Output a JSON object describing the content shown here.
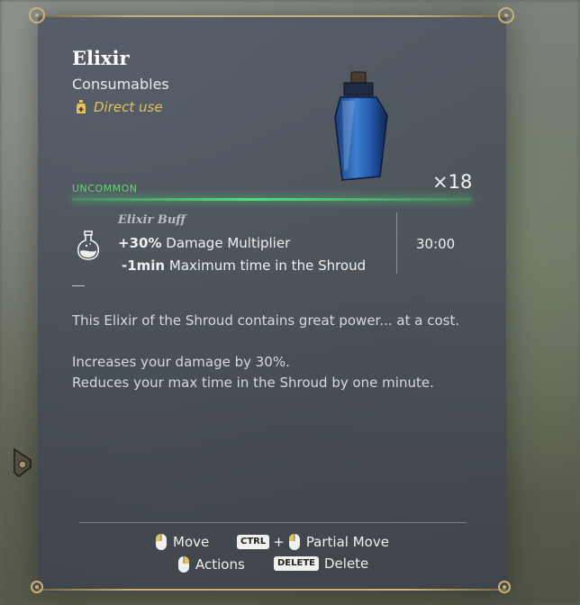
{
  "item": {
    "name": "Elixir",
    "category": "Consumables",
    "usage": "Direct use",
    "rarity": "UNCOMMON",
    "quantity": "×18"
  },
  "buff": {
    "name": "Elixir Buff",
    "effects": [
      {
        "value": "+30%",
        "label": "Damage Multiplier"
      },
      {
        "value": "-1min",
        "label": "Maximum time in the Shroud"
      }
    ],
    "duration": "30:00"
  },
  "description": {
    "lore": "This Elixir of the Shroud contains great power... at a cost.",
    "line1": "Increases your damage by 30%.",
    "line2": "Reduces your max time in the Shroud by one minute."
  },
  "controls": {
    "move": "Move",
    "ctrl_key": "CTRL",
    "plus": "+",
    "partial_move": "Partial Move",
    "actions": "Actions",
    "delete_key": "DELETE",
    "delete": "Delete"
  },
  "colors": {
    "rarity": "#6cd07a",
    "usage": "#e4c25a",
    "frame": "#c8b27a"
  }
}
